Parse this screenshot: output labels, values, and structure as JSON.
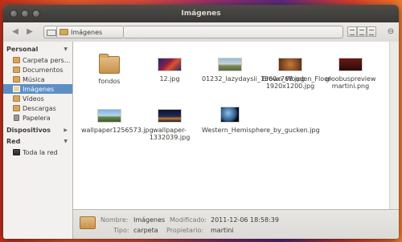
{
  "window": {
    "title": "Imágenes"
  },
  "toolbar": {
    "path_current": "Imágenes"
  },
  "sidebar": {
    "personal": "Personal",
    "personal_items": [
      {
        "label": "Carpeta pers..."
      },
      {
        "label": "Documentos"
      },
      {
        "label": "Música"
      },
      {
        "label": "Imágenes"
      },
      {
        "label": "Vídeos"
      },
      {
        "label": "Descargas"
      },
      {
        "label": "Papelera"
      }
    ],
    "devices": "Dispositivos",
    "network": "Red",
    "network_items": [
      {
        "label": "Toda la red"
      }
    ]
  },
  "files": [
    {
      "name": "fondos"
    },
    {
      "name": "12.jpg"
    },
    {
      "name": "01232_lazydaysii_1360x768.jpg"
    },
    {
      "name": "Brown_Wooden_Floor-1920x1200.jpg"
    },
    {
      "name": "gloobuspreview martini.png"
    },
    {
      "name": "wallpaper1256573.jpg"
    },
    {
      "name": "wallpaper-1332039.jpg"
    },
    {
      "name": "Western_Hemisphere_by_gucken.jpg"
    }
  ],
  "status": {
    "nombre_label": "Nombre:",
    "nombre": "Imágenes",
    "tipo_label": "Tipo:",
    "tipo": "carpeta",
    "modificado_label": "Modificado:",
    "modificado": "2011-12-06 18:58:39",
    "propietario_label": "Propietario:",
    "propietario": "martini"
  },
  "colors": {
    "selection": "#5d8fc4",
    "titlebar": "#3f3e3a"
  }
}
